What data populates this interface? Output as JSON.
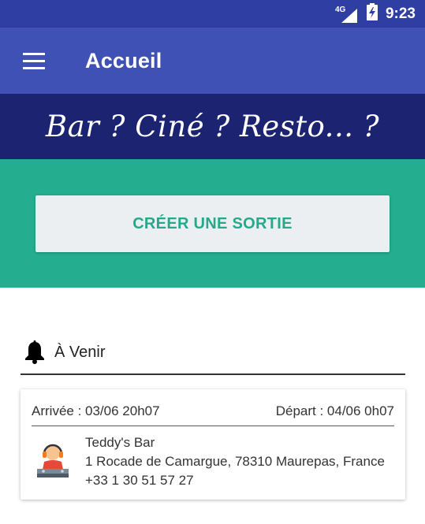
{
  "status_bar": {
    "network": "4G",
    "time": "9:23",
    "icons": [
      "signal-icon",
      "battery-charging-icon"
    ]
  },
  "app_bar": {
    "title": "Accueil",
    "menu_icon": "menu-icon"
  },
  "banner": {
    "text": "Bar ? Ciné ? Resto... ?"
  },
  "actions": {
    "create_label": "CRÉER UNE SORTIE"
  },
  "upcoming": {
    "icon": "bell-icon",
    "title": "À Venir"
  },
  "events": [
    {
      "arrival": "Arrivée : 03/06 20h07",
      "departure": "Départ : 04/06 0h07",
      "icon": "bar-dj-icon",
      "name": "Teddy's Bar",
      "address": "1 Rocade de Camargue, 78310 Maurepas, France",
      "phone": "+33 1 30 51 57 27"
    }
  ],
  "colors": {
    "status_bar": "#2f3ea3",
    "app_bar": "#3f51b5",
    "banner": "#1c2371",
    "accent": "#25ad8f",
    "button": "#eceff1"
  }
}
